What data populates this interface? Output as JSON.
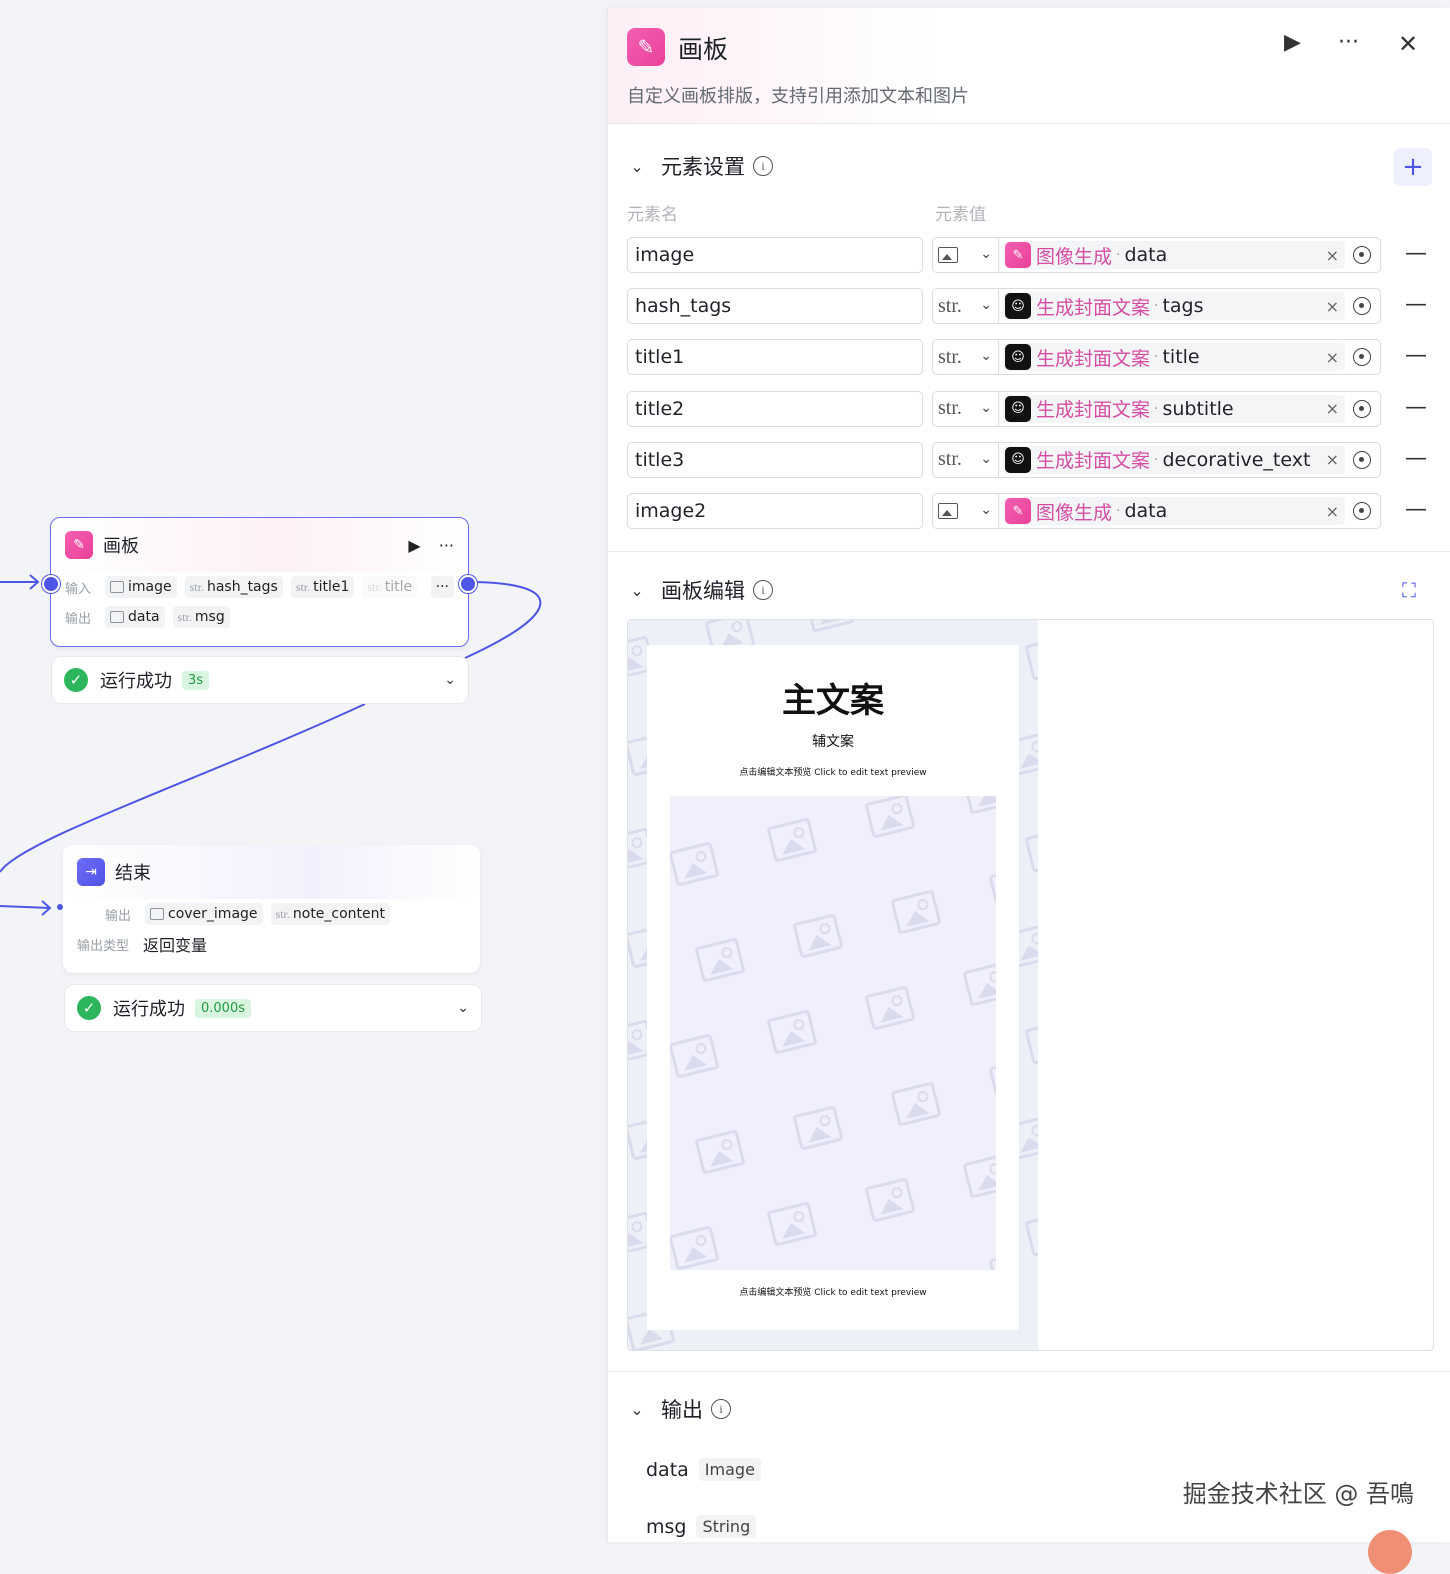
{
  "canvas": {
    "board_node": {
      "title": "画板",
      "input_label": "输入",
      "output_label": "输出",
      "inputs": [
        {
          "type": "image",
          "name": "image"
        },
        {
          "type": "str.",
          "name": "hash_tags"
        },
        {
          "type": "str.",
          "name": "title1"
        },
        {
          "type": "str.",
          "name": "title"
        }
      ],
      "more": "···",
      "outputs": [
        {
          "type": "image",
          "name": "data"
        },
        {
          "type": "str.",
          "name": "msg"
        }
      ],
      "status": {
        "text": "运行成功",
        "duration": "3s"
      }
    },
    "end_node": {
      "title": "结束",
      "output_label": "输出",
      "outputs": [
        {
          "type": "image",
          "name": "cover_image"
        },
        {
          "type": "str.",
          "name": "note_content"
        }
      ],
      "output_type_label": "输出类型",
      "output_type_value": "返回变量",
      "status": {
        "text": "运行成功",
        "duration": "0.000s"
      }
    }
  },
  "panel": {
    "title": "画板",
    "description": "自定义画板排版，支持引用添加文本和图片",
    "element_section": {
      "title": "元素设置",
      "col_name": "元素名",
      "col_value": "元素值",
      "rows": [
        {
          "name": "image",
          "type": "image",
          "source": "图像生成",
          "source_icon": "pink",
          "field": "data"
        },
        {
          "name": "hash_tags",
          "type": "str.",
          "source": "生成封面文案",
          "source_icon": "black",
          "field": "tags"
        },
        {
          "name": "title1",
          "type": "str.",
          "source": "生成封面文案",
          "source_icon": "black",
          "field": "title"
        },
        {
          "name": "title2",
          "type": "str.",
          "source": "生成封面文案",
          "source_icon": "black",
          "field": "subtitle"
        },
        {
          "name": "title3",
          "type": "str.",
          "source": "生成封面文案",
          "source_icon": "black",
          "field": "decorative_text"
        },
        {
          "name": "image2",
          "type": "image",
          "source": "图像生成",
          "source_icon": "pink",
          "field": "data"
        }
      ]
    },
    "board_section": {
      "title": "画板编辑",
      "main_text": "主文案",
      "sub_text": "辅文案",
      "hint_top": "点击编辑文本预览 Click to edit text preview",
      "hint_bottom": "点击编辑文本预览 Click to edit text preview"
    },
    "output_section": {
      "title": "输出",
      "items": [
        {
          "name": "data",
          "type": "Image"
        },
        {
          "name": "msg",
          "type": "String"
        }
      ]
    }
  },
  "watermark": "掘金技术社区 @ 吾鳴",
  "colors": {
    "accent": "#4e56e6",
    "success": "#2db55d",
    "source_text": "#d64ea3"
  }
}
